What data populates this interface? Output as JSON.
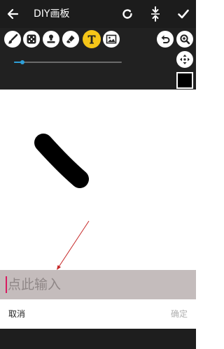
{
  "header": {
    "title": "DIY画板",
    "icons": [
      "back-arrow-icon",
      "rotate-icon",
      "compress-icon",
      "check-icon"
    ]
  },
  "toolbar": {
    "tools": [
      "brush-icon",
      "dice-icon",
      "stamp-icon",
      "eraser-icon",
      "text-icon",
      "image-icon"
    ],
    "active_tool": "text-icon",
    "active_color": "#f5c518",
    "right_tools": [
      "undo-icon",
      "zoom-icon",
      "move-icon"
    ],
    "brush_size": {
      "value": "50",
      "fill_fraction": 0.08
    },
    "current_color": "#000000"
  },
  "input": {
    "placeholder": "点此输入",
    "value": ""
  },
  "actions": {
    "cancel_label": "取消",
    "confirm_label": "确定"
  },
  "colors": {
    "bar_background": "#1c1c1c",
    "slider_accent": "#2d9fd8",
    "input_background": "#c4bcbc",
    "annotation_line": "#c62828"
  }
}
